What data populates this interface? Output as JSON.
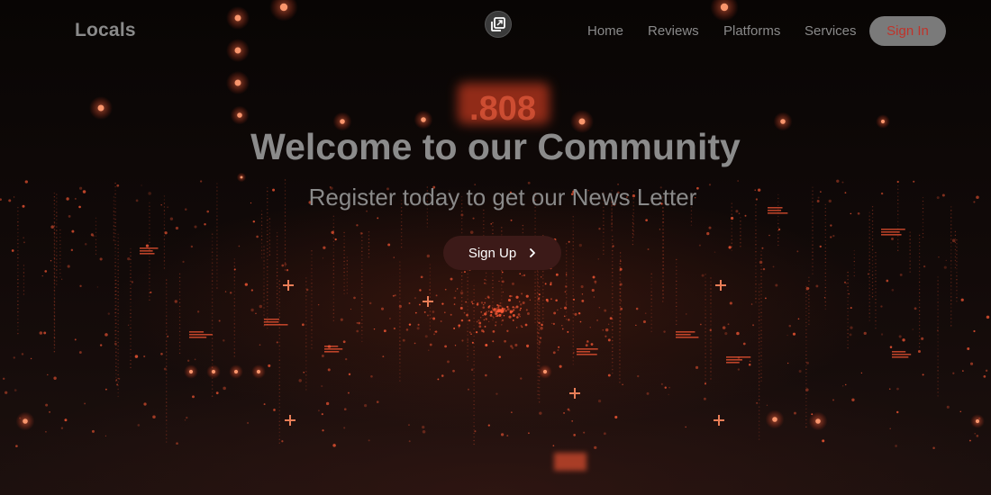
{
  "brand": {
    "name": "Locals"
  },
  "nav": {
    "links": [
      "Home",
      "Reviews",
      "Platforms",
      "Services"
    ],
    "signin_label": "Sign In"
  },
  "hero": {
    "title": "Welcome to our Community",
    "subtitle": "Register today to get our News Letter",
    "cta_label": "Sign Up"
  },
  "icons": {
    "center_toggle": "copy-icon",
    "cta_arrow": "chevron-right-icon"
  },
  "colors": {
    "accent": "#ff5a36",
    "signup_bg": "#3c1a18",
    "signin_bg": "#7a7a7a",
    "signin_text": "#c0332a",
    "muted_text": "#8a8a8a"
  }
}
